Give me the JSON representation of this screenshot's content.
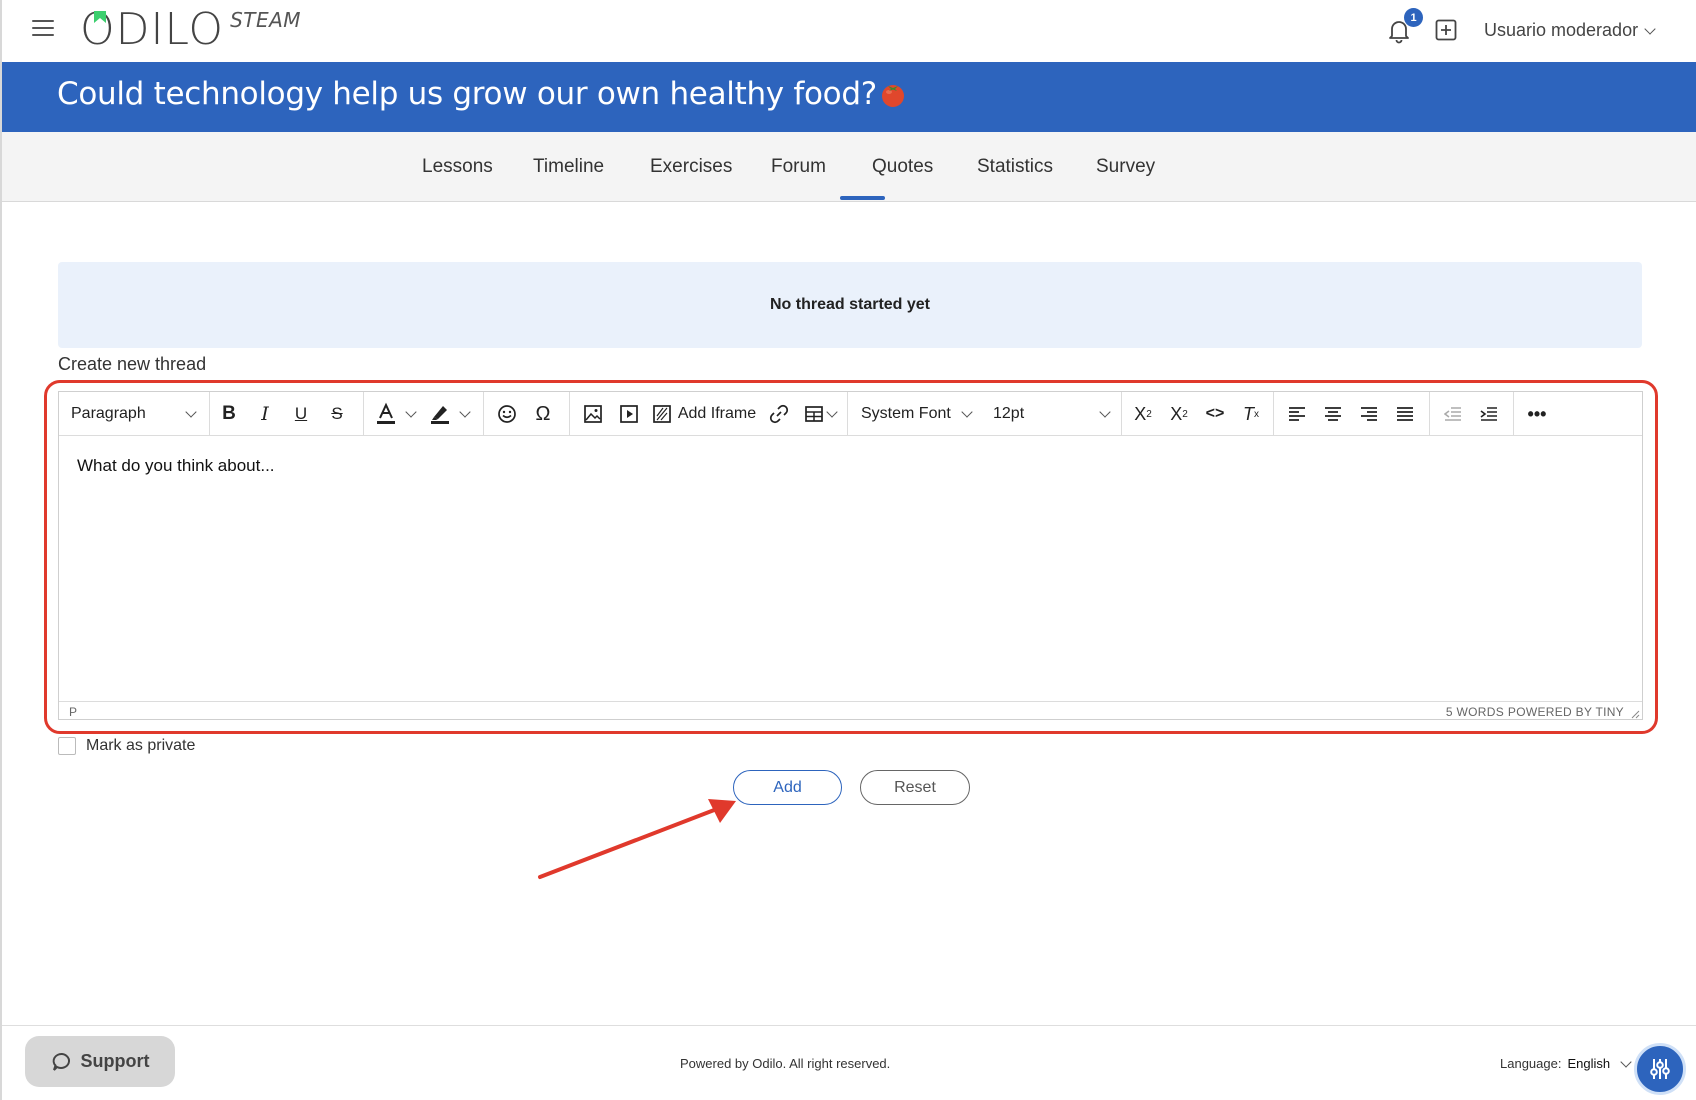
{
  "header": {
    "logo_text": "ODILO",
    "logo_sub": "STEAM",
    "notification_count": "1",
    "user_name": "Usuario moderador"
  },
  "course": {
    "title": "Could technology help us grow our own healthy food?"
  },
  "tabs": [
    {
      "label": "Lessons"
    },
    {
      "label": "Timeline"
    },
    {
      "label": "Exercises"
    },
    {
      "label": "Forum",
      "active": true
    },
    {
      "label": "Quotes"
    },
    {
      "label": "Statistics"
    },
    {
      "label": "Survey"
    }
  ],
  "forum": {
    "empty_notice": "No thread started yet",
    "create_label": "Create new thread"
  },
  "editor": {
    "block_format": "Paragraph",
    "add_iframe_label": "Add Iframe",
    "font_family": "System Font",
    "font_size": "12pt",
    "content": "What do you think about...",
    "status_path": "P",
    "word_count": "5 WORDS",
    "powered_by": "POWERED BY TINY"
  },
  "form": {
    "private_label": "Mark as private",
    "add_label": "Add",
    "reset_label": "Reset"
  },
  "footer": {
    "support_label": "Support",
    "powered_text": "Powered by Odilo. All right reserved.",
    "language_label": "Language:",
    "language_value": "English"
  },
  "colors": {
    "brand_blue": "#2d64bd",
    "highlight_red": "#e0392c",
    "notice_bg": "#eaf1fb"
  }
}
